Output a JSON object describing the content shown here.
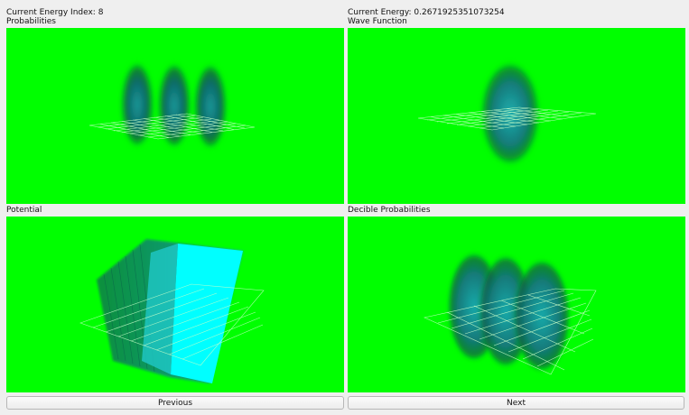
{
  "header": {
    "energy_index_label": "Current Energy Index: 8",
    "energy_label": "Current Energy: 0.2671925351073254"
  },
  "panels": [
    {
      "title": "Probabilities"
    },
    {
      "title": "Wave Function"
    },
    {
      "title": "Potential"
    },
    {
      "title": "Decible Probabilities"
    }
  ],
  "buttons": {
    "previous": "Previous",
    "next": "Next"
  },
  "colors": {
    "background": "#00ff00",
    "volume": "#00c8c8",
    "grid": "#d8ffd8"
  }
}
